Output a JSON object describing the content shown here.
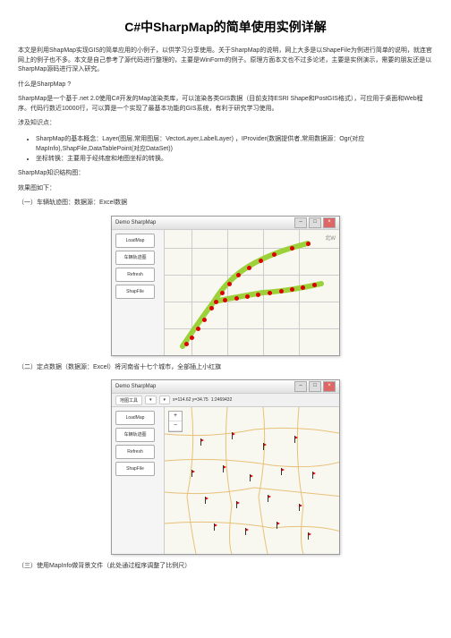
{
  "title": "C#中SharpMap的简单使用实例详解",
  "intro": "本文是利用ShapMap实现GIS的简单应用的小例子，以供学习分享使用。关于SharpMap的说明，网上大多是以ShapeFile为例进行简单的说明，就连官网上的例子也不多。本文是自己参考了源代码进行整理的，主要是WinForm的例子。原理方面本文也不过多论述，主要是实例演示，需要的朋友还是以SharpMap源码进行深入研究。",
  "q_title": "什么是SharpMap ?",
  "q_body": "SharpMap是一个基于.net 2.0使用C#开发的Map渲染类库，可以渲染各类GIS数据（目前支持ESRI Shape和PostGIS格式），可应用于桌面和Web程序。代码行数近10000行，可以算是一个实现了最基本功能的GIS系统，有利于研究学习使用。",
  "involve_title": "涉及知识点：",
  "bullet1": "SharpMap的基本概念：Layer(图层,常用图层：VectorLayer,LabelLayer) ，IProvider(数据提供者,常用数据源：Ogr(对应MapInfo),ShapFile,DataTablePoint(对应DataSet))",
  "bullet2": "坐标转换：主要用于经纬度和地图坐标的转换。",
  "know_title": "SharpMap知识结构图：",
  "effect_title": "效果图如下：",
  "ex1_label": "（一）车辆轨迹图：数据源：Excel数据",
  "ex2_label": "（二）定点数据（数据源：Excel）将河南省十七个城市，全部插上小红旗",
  "ex3_label": "（三）使用MapInfo做背景文件（此处通过程序调整了比例尺）",
  "window": {
    "title": "Demo SharpMap",
    "btn_load": "LoadMap",
    "btn_track": "车辆轨迹图",
    "btn_refresh": "Refresh",
    "btn_shapefile": "ShapFile"
  },
  "toolbar": {
    "item1": "地图工具",
    "coord": "x=114.62 y=34.75",
    "zoom": "1:2469432"
  },
  "compass": "北W"
}
